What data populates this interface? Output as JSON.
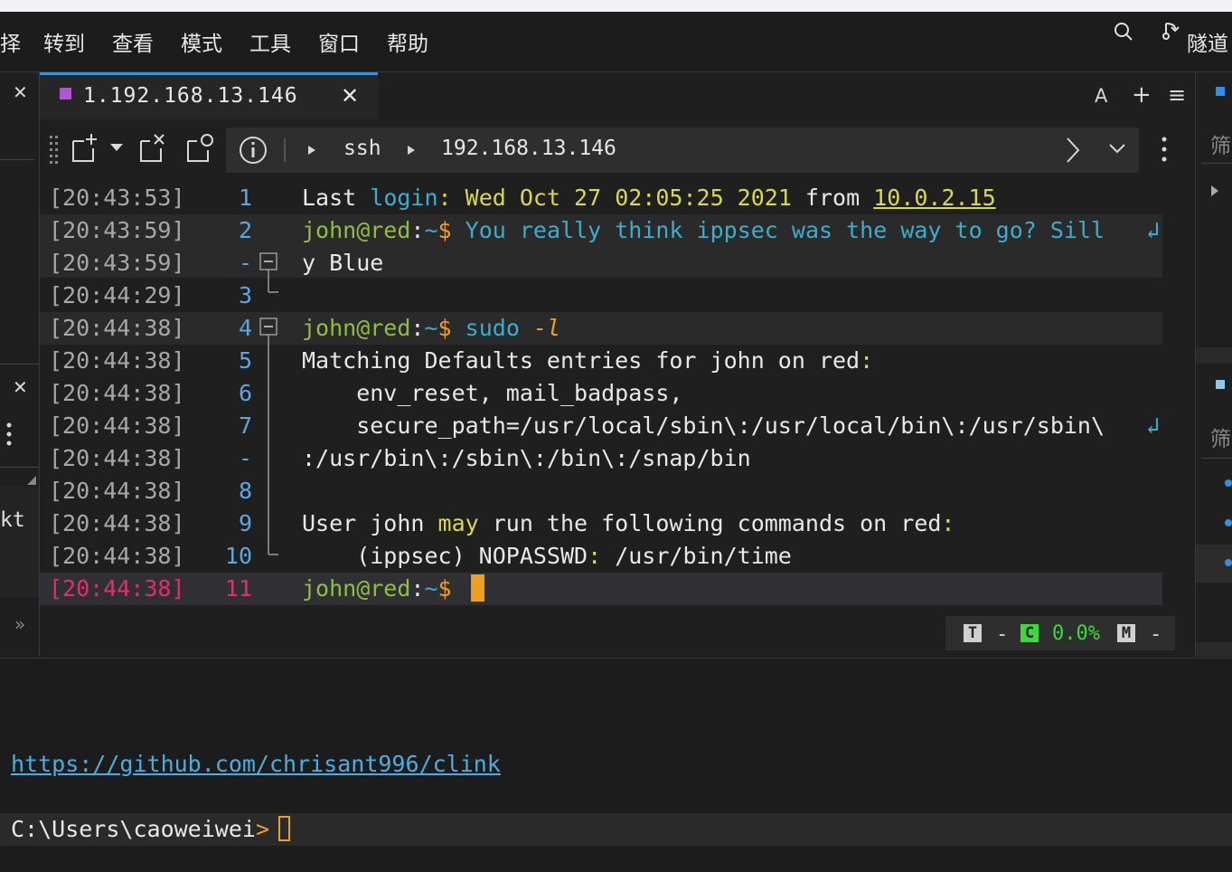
{
  "menu": {
    "items": [
      "择",
      "转到",
      "查看",
      "模式",
      "工具",
      "窗口",
      "帮助"
    ],
    "tunnel_label": "隧道"
  },
  "tab": {
    "title": "1.192.168.13.146",
    "close_glyph": "✕",
    "font_label": "A",
    "add_glyph": "+",
    "menu_glyph": "≡"
  },
  "address_bar": {
    "protocol": "ssh",
    "host": "192.168.13.146"
  },
  "left_panel": {
    "close_glyph": "✕",
    "close_glyph_2": "✕",
    "partial_text": "kt",
    "expand_glyph": "»"
  },
  "right_panel": {
    "filter_label_1": "筛",
    "filter_label_2": "筛"
  },
  "terminal": {
    "rows": [
      {
        "ts": "[20:43:53]",
        "ln": "1"
      },
      {
        "ts": "[20:43:59]",
        "ln": "2"
      },
      {
        "ts": "[20:43:59]",
        "ln": "-"
      },
      {
        "ts": "[20:44:29]",
        "ln": "3"
      },
      {
        "ts": "[20:44:38]",
        "ln": "4"
      },
      {
        "ts": "[20:44:38]",
        "ln": "5"
      },
      {
        "ts": "[20:44:38]",
        "ln": "6"
      },
      {
        "ts": "[20:44:38]",
        "ln": "7"
      },
      {
        "ts": "[20:44:38]",
        "ln": "-"
      },
      {
        "ts": "[20:44:38]",
        "ln": "8"
      },
      {
        "ts": "[20:44:38]",
        "ln": "9"
      },
      {
        "ts": "[20:44:38]",
        "ln": "10"
      },
      {
        "ts": "[20:44:38]",
        "ln": "11"
      }
    ],
    "line1": {
      "a": "Last ",
      "b": "login",
      "c": ": ",
      "d": "Wed Oct 27 02:05:25 2021",
      "e": " from ",
      "f": "10.0.2.15"
    },
    "prompt_user": "john@red",
    "prompt_colon": ":",
    "prompt_path": "~",
    "prompt_dollar": "$",
    "line2_text": "You really think ippsec was the way to go? Sill",
    "line2_cont": "y Blue",
    "line4_cmd": "sudo",
    "line4_flag": "-l",
    "line5_a": "Matching Defaults entries for john on red",
    "line5_colon": ":",
    "line6": "    env_reset, mail_badpass,",
    "line7_a": "    secure_path=/usr/local/sbin\\:/usr/local/bin\\:/usr/sbin\\",
    "line7_cont": ":/usr/bin\\:/sbin\\:/bin\\:/snap/bin",
    "line9_a": "User john ",
    "line9_may": "may",
    "line9_b": " run the following commands on red",
    "line9_colon": ":",
    "line10_a": "    (ippsec) NOPASSWD",
    "line10_colon": ":",
    "line10_b": " /usr/bin/time",
    "wrap_glyph": "↲"
  },
  "status": {
    "t_label": "T",
    "dash1": "-",
    "c_label": "C",
    "percent": "0.0%",
    "m_label": "M",
    "dash2": "-"
  },
  "bottom": {
    "url": "https://github.com/chrisant996/clink",
    "prompt": "C:\\Users\\caoweiwei",
    "prompt_gt": ">"
  },
  "colors": {
    "accent": "#3d8fd6",
    "tab_marker": "#b453d6",
    "prompt_green": "#8fbf3f",
    "orange": "#f0a020",
    "teal": "#3aaecf",
    "timestamp_active": "#e0306a",
    "status_green": "#3adc3a"
  }
}
